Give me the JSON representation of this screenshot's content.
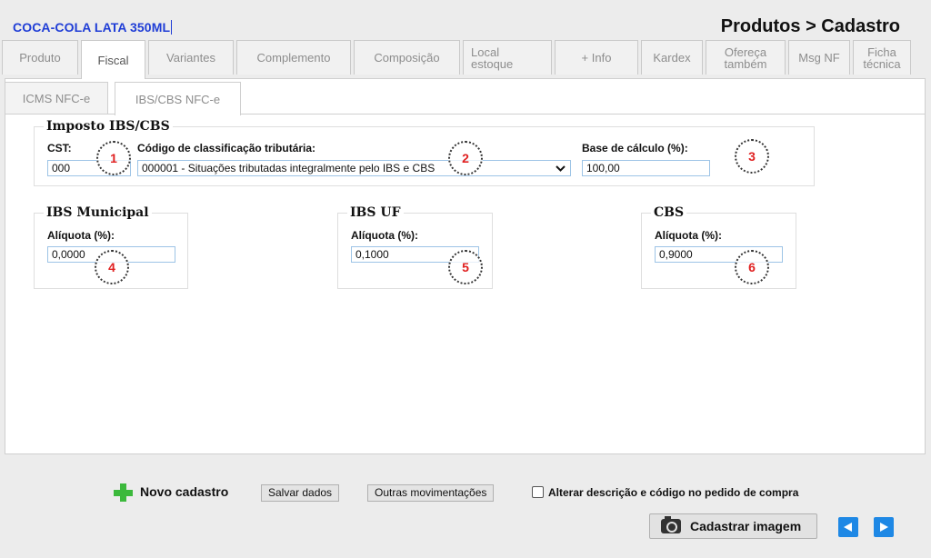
{
  "header": {
    "product_name": "COCA-COLA LATA 350ML",
    "breadcrumb": "Produtos > Cadastro"
  },
  "tabs": [
    {
      "label": "Produto"
    },
    {
      "label": "Fiscal",
      "active": true
    },
    {
      "label": "Variantes"
    },
    {
      "label": "Complemento"
    },
    {
      "label": "Composição"
    },
    {
      "label": "Local estoque"
    },
    {
      "label": "+ Info"
    },
    {
      "label": "Kardex"
    },
    {
      "label": "Ofereça também"
    },
    {
      "label": "Msg NF"
    },
    {
      "label": "Ficha técnica"
    }
  ],
  "subtabs": [
    {
      "label": "ICMS NFC-e"
    },
    {
      "label": "IBS/CBS NFC-e",
      "active": true
    }
  ],
  "imposto": {
    "legend": "Imposto IBS/CBS",
    "cst_label": "CST:",
    "cst_value": "000",
    "class_label": "Código de classificação tributária:",
    "class_value": "000001 - Situações tributadas integralmente pelo IBS e CBS",
    "base_label": "Base de cálculo (%):",
    "base_value": "100,00"
  },
  "ibs_municipal": {
    "legend": "IBS Municipal",
    "label": "Alíquota (%):",
    "value": "0,0000"
  },
  "ibs_uf": {
    "legend": "IBS UF",
    "label": "Alíquota (%):",
    "value": "0,1000"
  },
  "cbs": {
    "legend": "CBS",
    "label": "Alíquota (%):",
    "value": "0,9000"
  },
  "markers": [
    "1",
    "2",
    "3",
    "4",
    "5",
    "6"
  ],
  "footer": {
    "novo_label": "Novo cadastro",
    "salvar_label": "Salvar dados",
    "outras_label": "Outras movimentações",
    "checkbox_label": "Alterar descrição e código no pedido de compra",
    "checkbox_checked": false,
    "camera_label": "Cadastrar imagem"
  },
  "icons": {
    "add": "plus-icon",
    "camera": "camera-icon",
    "prev": "arrow-left-icon",
    "next": "arrow-right-icon"
  },
  "colors": {
    "product_name": "#1f3dd6",
    "marker_text": "#e02020",
    "nav_button": "#1e88e5",
    "plus_icon": "#3cb93c"
  }
}
